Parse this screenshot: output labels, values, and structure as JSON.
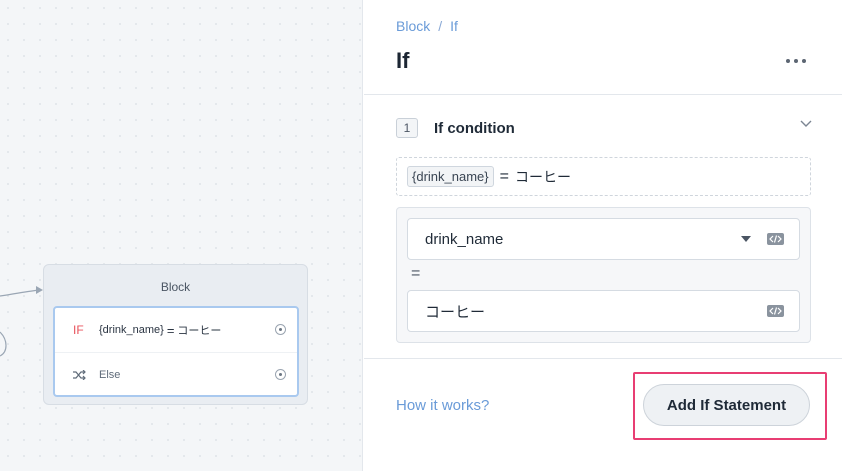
{
  "canvas": {
    "block": {
      "title": "Block",
      "if_label": "IF",
      "condition_var": "{drink_name}",
      "condition_op": "=",
      "condition_value": "コーヒー",
      "else_label": "Else"
    }
  },
  "panel": {
    "breadcrumb": {
      "parent": "Block",
      "separator": "/",
      "current": "If"
    },
    "title": "If",
    "condition": {
      "number": "1",
      "title": "If condition",
      "summary_var": "{drink_name}",
      "summary_op": "=",
      "summary_value": "コーヒー",
      "left_operand": "drink_name",
      "operator": "=",
      "right_operand": "コーヒー"
    },
    "help_link": "How it works?",
    "add_button": "Add If Statement"
  },
  "colors": {
    "accent_link": "#6a9bd8",
    "if_red": "#e8525b",
    "highlight": "#e83e73"
  }
}
